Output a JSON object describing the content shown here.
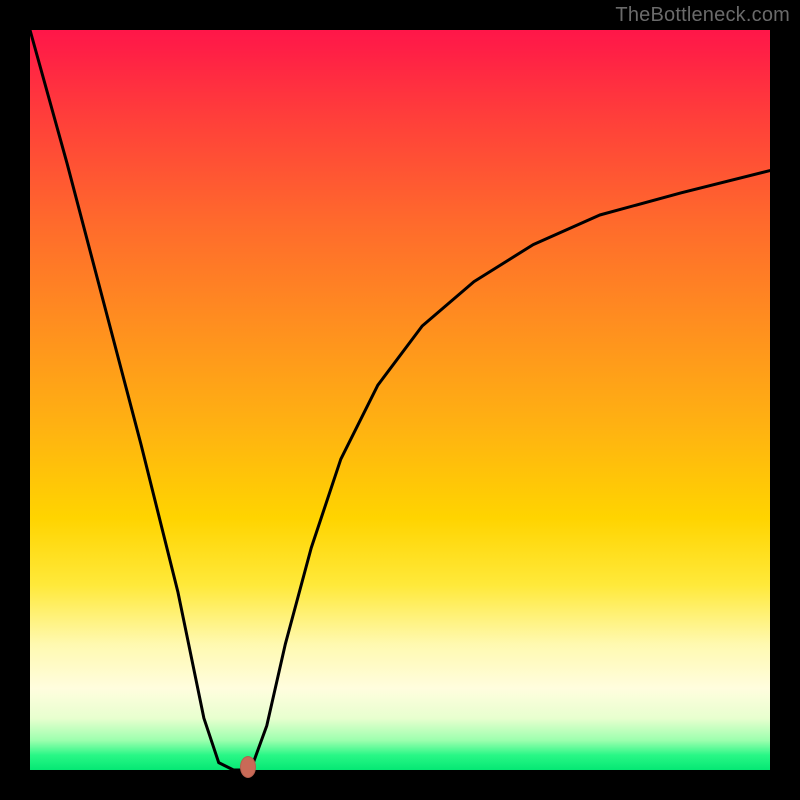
{
  "watermark": "TheBottleneck.com",
  "chart_data": {
    "type": "line",
    "title": "",
    "xlabel": "",
    "ylabel": "",
    "xlim": [
      0,
      1
    ],
    "ylim": [
      0,
      1
    ],
    "series": [
      {
        "name": "bottleneck-curve",
        "x": [
          0.0,
          0.05,
          0.1,
          0.15,
          0.2,
          0.235,
          0.255,
          0.275,
          0.295,
          0.3,
          0.32,
          0.345,
          0.38,
          0.42,
          0.47,
          0.53,
          0.6,
          0.68,
          0.77,
          0.88,
          1.0
        ],
        "values": [
          1.0,
          0.82,
          0.63,
          0.44,
          0.24,
          0.07,
          0.01,
          0.0,
          0.0,
          0.005,
          0.06,
          0.17,
          0.3,
          0.42,
          0.52,
          0.6,
          0.66,
          0.71,
          0.75,
          0.78,
          0.81
        ]
      }
    ],
    "marker": {
      "x": 0.295,
      "y": 0.0
    },
    "background_gradient": {
      "stops": [
        {
          "pos": 0.0,
          "color": "#ff1649"
        },
        {
          "pos": 0.12,
          "color": "#ff3f3a"
        },
        {
          "pos": 0.26,
          "color": "#ff6a2c"
        },
        {
          "pos": 0.4,
          "color": "#ff8f1f"
        },
        {
          "pos": 0.54,
          "color": "#ffb311"
        },
        {
          "pos": 0.66,
          "color": "#ffd400"
        },
        {
          "pos": 0.75,
          "color": "#ffe93a"
        },
        {
          "pos": 0.83,
          "color": "#fff9b0"
        },
        {
          "pos": 0.89,
          "color": "#fffdde"
        },
        {
          "pos": 0.93,
          "color": "#e8ffcf"
        },
        {
          "pos": 0.96,
          "color": "#9cffae"
        },
        {
          "pos": 0.98,
          "color": "#29f786"
        },
        {
          "pos": 1.0,
          "color": "#05e874"
        }
      ]
    }
  }
}
